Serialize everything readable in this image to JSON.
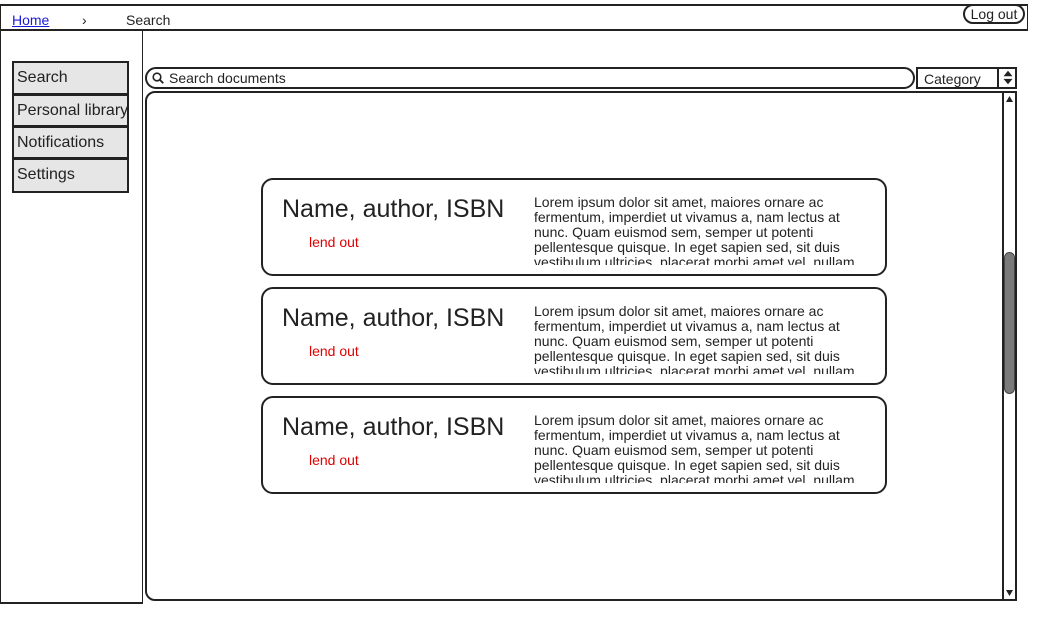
{
  "breadcrumb": {
    "home": "Home",
    "separator": "›",
    "current": "Search"
  },
  "header": {
    "logout_label": "Log out"
  },
  "sidebar": {
    "items": [
      {
        "label": "Search"
      },
      {
        "label": "Personal library"
      },
      {
        "label": "Notifications"
      },
      {
        "label": "Settings"
      }
    ]
  },
  "search": {
    "placeholder": "Search documents",
    "icon": "search-icon"
  },
  "filter": {
    "selected": "Category"
  },
  "results": [
    {
      "title": "Name, author, ISBN",
      "action": "lend out",
      "description": "Lorem ipsum dolor sit amet, maiores ornare ac fermentum, imperdiet ut vivamus a, nam lectus at nunc. Quam euismod sem, semper ut potenti pellentesque quisque. In eget sapien sed, sit duis vestibulum ultricies, placerat morbi amet vel, nullam"
    },
    {
      "title": "Name, author, ISBN",
      "action": "lend out",
      "description": "Lorem ipsum dolor sit amet, maiores ornare ac fermentum, imperdiet ut vivamus a, nam lectus at nunc. Quam euismod sem, semper ut potenti pellentesque quisque. In eget sapien sed, sit duis vestibulum ultricies, placerat morbi amet vel, nullam"
    },
    {
      "title": "Name, author, ISBN",
      "action": "lend out",
      "description": "Lorem ipsum dolor sit amet, maiores ornare ac fermentum, imperdiet ut vivamus a, nam lectus at nunc. Quam euismod sem, semper ut potenti pellentesque quisque. In eget sapien sed, sit duis vestibulum ultricies, placerat morbi amet vel, nullam"
    }
  ],
  "colors": {
    "link": "#1a1ad8",
    "action": "#e00000",
    "nav_bg": "#e6e6e6",
    "scroll_thumb": "#7a7a7a"
  }
}
